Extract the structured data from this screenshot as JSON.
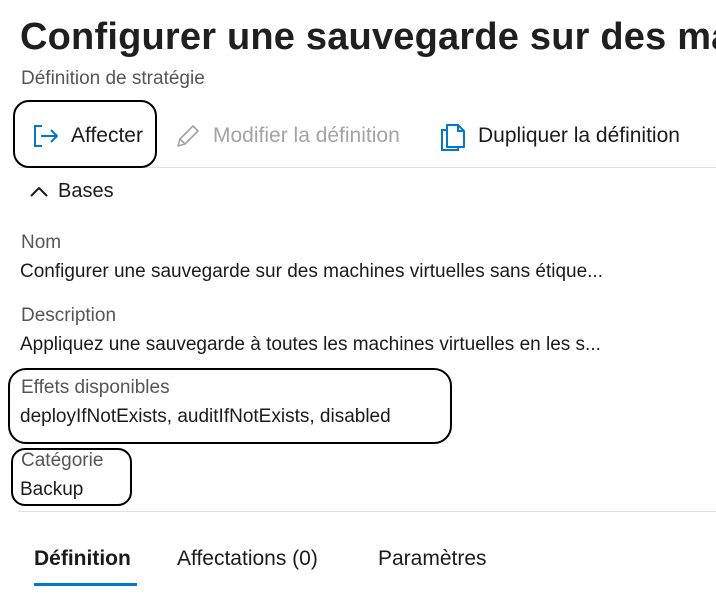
{
  "header": {
    "title": "Configurer une sauvegarde sur des ma",
    "subtitle": "Définition de stratégie"
  },
  "toolbar": {
    "assign_label": "Affecter",
    "modify_label": "Modifier la définition",
    "duplicate_label": "Dupliquer la définition"
  },
  "section": {
    "label": "Bases"
  },
  "fields": {
    "name": {
      "label": "Nom",
      "value": "Configurer une sauvegarde sur des machines virtuelles sans étique..."
    },
    "description": {
      "label": "Description",
      "value": "Appliquez une sauvegarde à toutes les machines virtuelles en les s..."
    },
    "effects": {
      "label": "Effets disponibles",
      "value": "deployIfNotExists, auditIfNotExists, disabled"
    },
    "category": {
      "label": "Catégorie",
      "value": "Backup"
    }
  },
  "tabs": [
    {
      "label": "Définition",
      "active": true
    },
    {
      "label": "Affectations (0)",
      "active": false
    },
    {
      "label": "Paramètres",
      "active": false
    }
  ],
  "colors": {
    "accent": "#0078d4",
    "disabled": "#a3a3a3",
    "callout_border": "#000000"
  }
}
